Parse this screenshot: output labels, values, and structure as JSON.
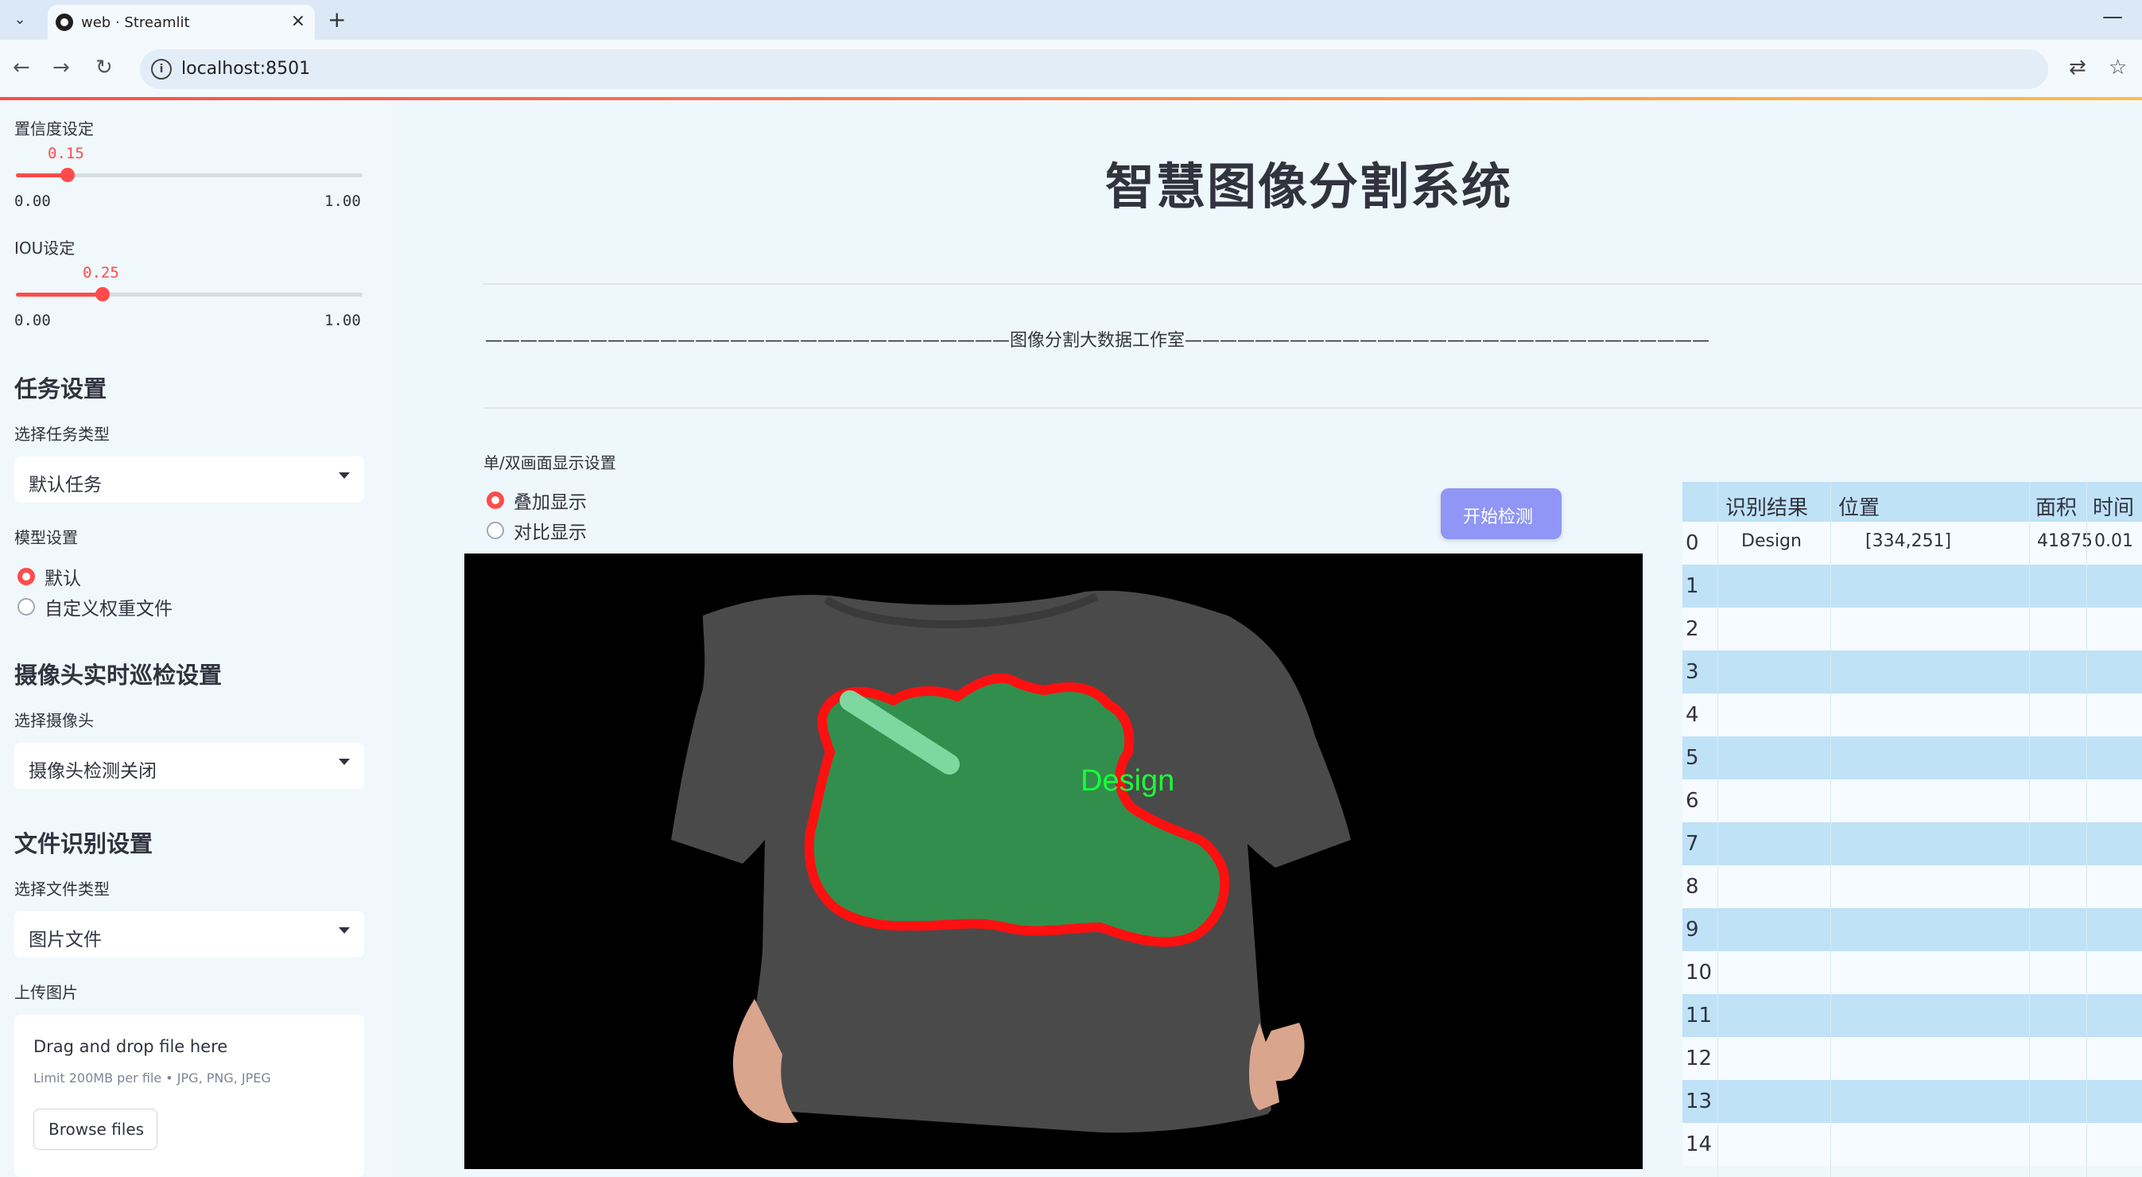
{
  "browser": {
    "tab_title": "web · Streamlit",
    "url": "localhost:8501"
  },
  "sidebar": {
    "confidence": {
      "label": "置信度设定",
      "value": "0.15",
      "min": "0.00",
      "max": "1.00",
      "fraction": 0.15
    },
    "iou": {
      "label": "IOU设定",
      "value": "0.25",
      "min": "0.00",
      "max": "1.00",
      "fraction": 0.25
    },
    "task_section": "任务设置",
    "task_type_label": "选择任务类型",
    "task_type_value": "默认任务",
    "model_label": "模型设置",
    "model_options": [
      "默认",
      "自定义权重文件"
    ],
    "model_selected": "默认",
    "camera_section": "摄像头实时巡检设置",
    "camera_label": "选择摄像头",
    "camera_value": "摄像头检测关闭",
    "file_section": "文件识别设置",
    "file_type_label": "选择文件类型",
    "file_type_value": "图片文件",
    "upload_label": "上传图片",
    "upload_title": "Drag and drop file here",
    "upload_sub": "Limit 200MB per file • JPG, PNG, JPEG",
    "upload_button": "Browse files"
  },
  "main": {
    "title": "智慧图像分割系统",
    "divider_text": "——————————————————————————————图像分割大数据工作室——————————————————————————————",
    "display_label": "单/双画面显示设置",
    "display_options": [
      "叠加显示",
      "对比显示"
    ],
    "display_selected": "叠加显示",
    "start_button": "开始检测",
    "detection_label": "Design"
  },
  "table": {
    "headers": [
      "识别结果",
      "位置",
      "面积",
      "时间"
    ],
    "rows": [
      {
        "index": "0",
        "result": "Design",
        "position": "[334,251]",
        "area": "41875",
        "time": "0.01"
      },
      {
        "index": "1"
      },
      {
        "index": "2"
      },
      {
        "index": "3"
      },
      {
        "index": "4"
      },
      {
        "index": "5"
      },
      {
        "index": "6"
      },
      {
        "index": "7"
      },
      {
        "index": "8"
      },
      {
        "index": "9"
      },
      {
        "index": "10"
      },
      {
        "index": "11"
      },
      {
        "index": "12"
      },
      {
        "index": "13"
      },
      {
        "index": "14"
      }
    ]
  },
  "colors": {
    "accent": "#ff4b4b",
    "button": "#8f96f5",
    "table_stripe": "#bfe2f7",
    "mask_green": "#2e9a4e",
    "mask_outline": "#ff1010"
  }
}
